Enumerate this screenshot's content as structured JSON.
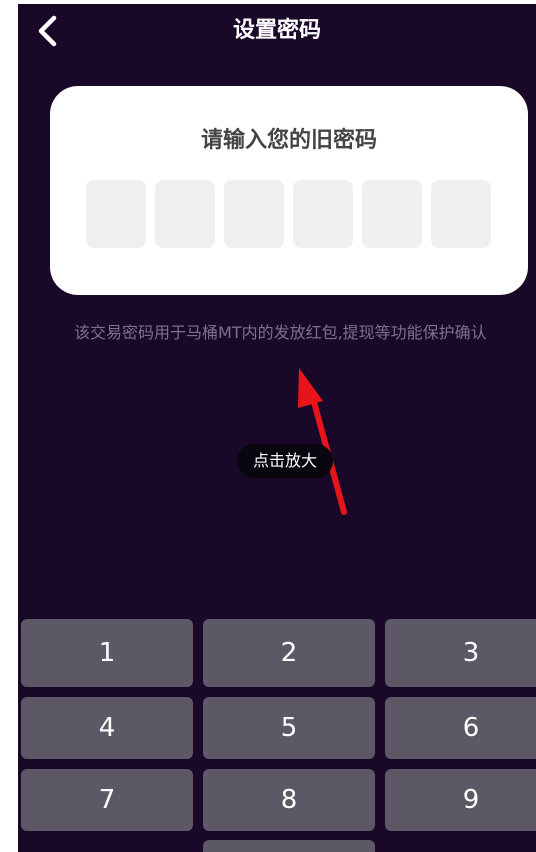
{
  "header": {
    "title": "设置密码",
    "back_icon": "chevron-left-icon"
  },
  "card": {
    "title": "请输入您的旧密码",
    "pin_length": 6
  },
  "hint": "该交易密码用于马桶MT内的发放红包,提现等功能保护确认",
  "overlay": {
    "zoom_label": "点击放大",
    "arrow_icon": "red-arrow-icon",
    "arrow_color": "#e8141b"
  },
  "keypad": {
    "keys": [
      "1",
      "2",
      "3",
      "4",
      "5",
      "6",
      "7",
      "8",
      "9"
    ]
  },
  "colors": {
    "background": "#1a0828",
    "card": "#ffffff",
    "pin_box": "#efefef",
    "key": "#5d5865",
    "hint": "#7e6f8c"
  }
}
